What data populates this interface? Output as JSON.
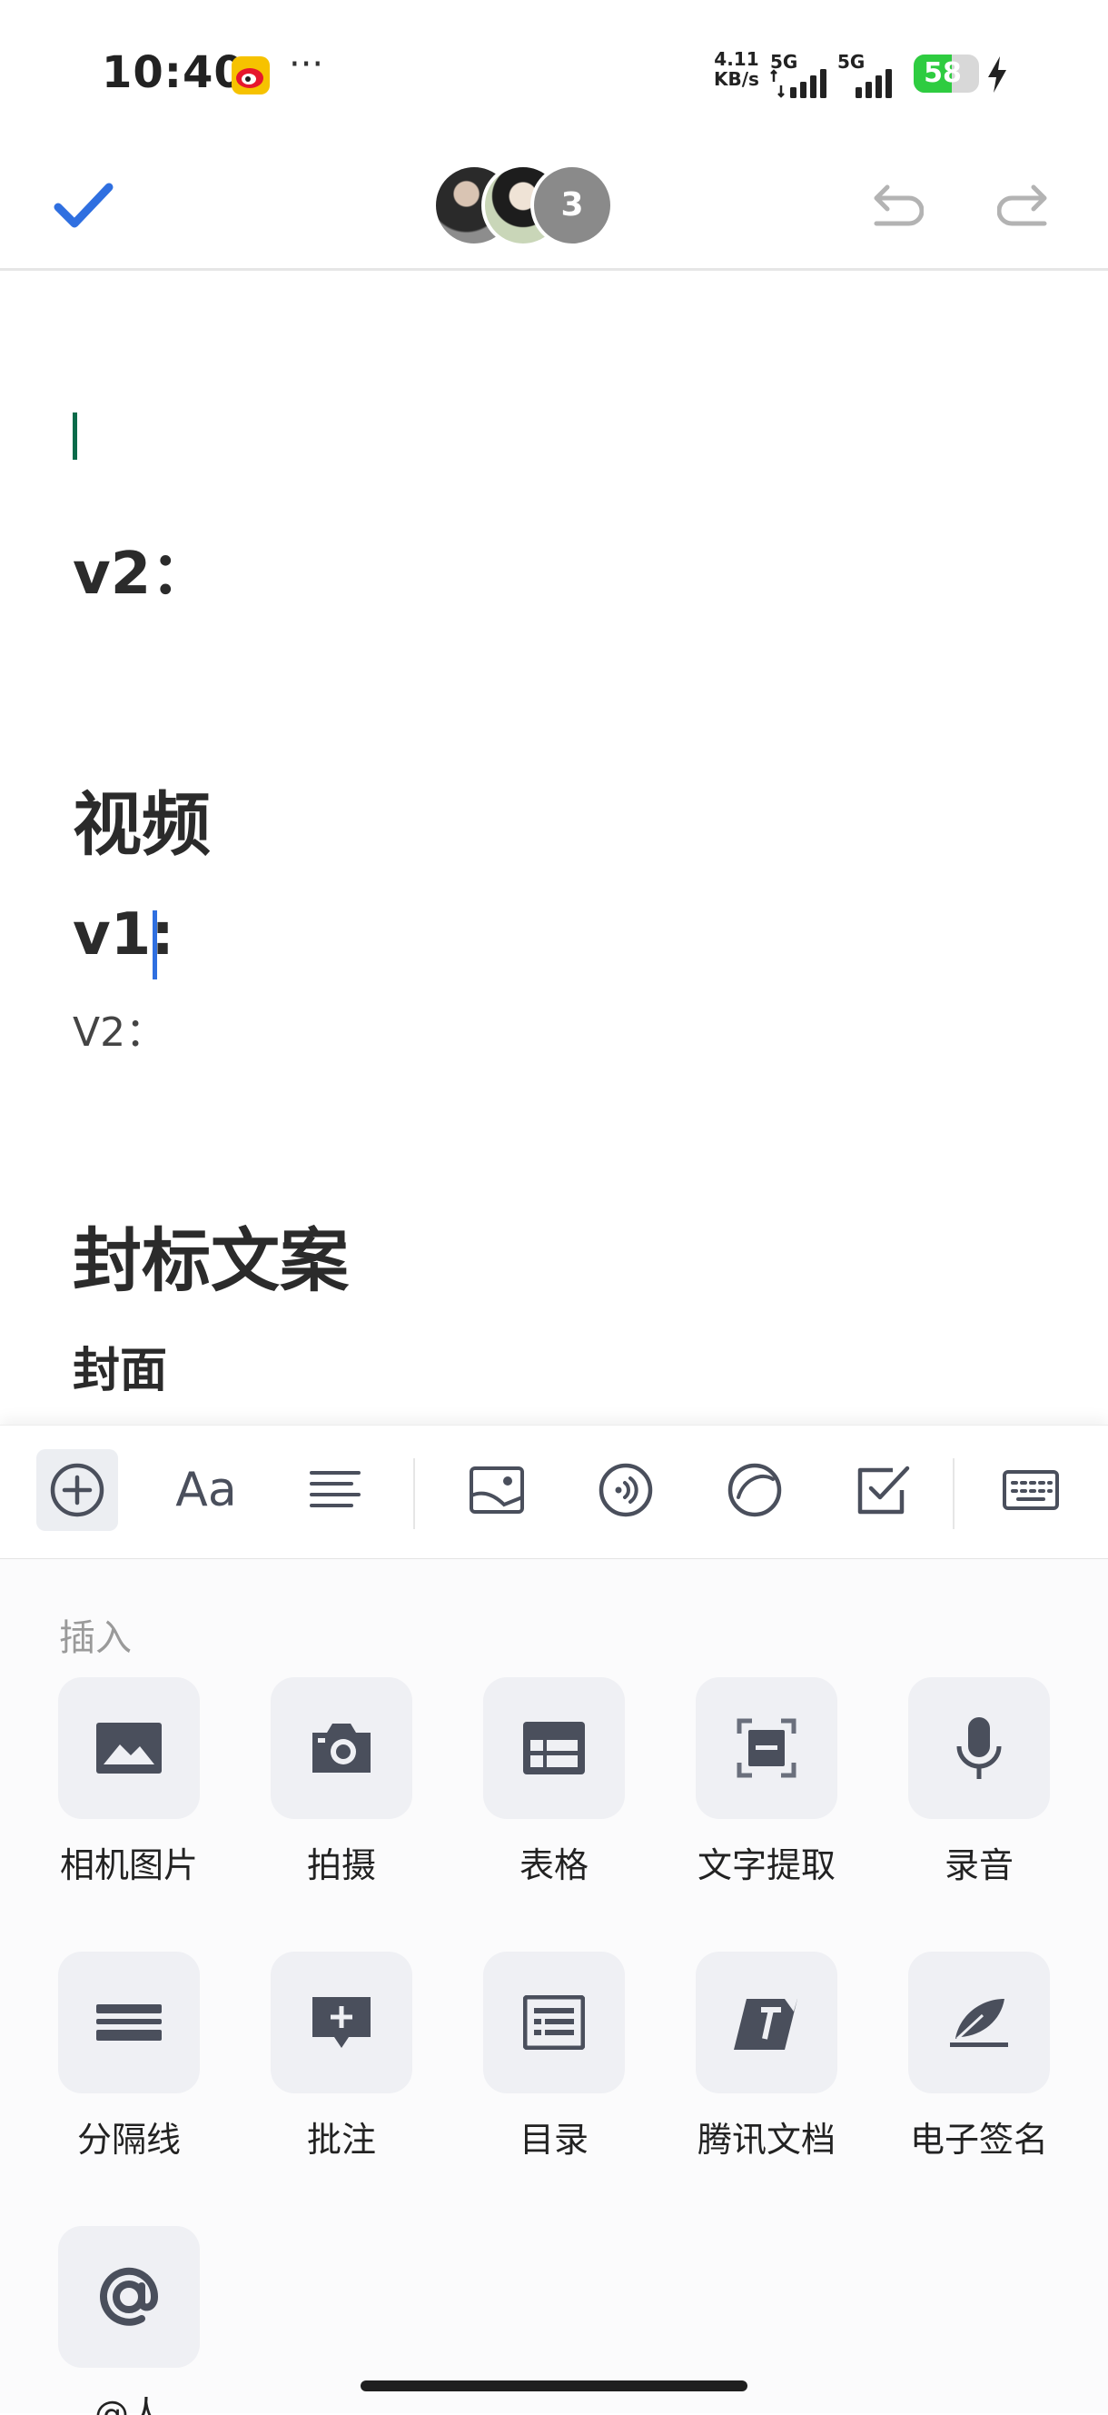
{
  "status_bar": {
    "time": "10:40",
    "net_speed_value": "4.11",
    "net_speed_unit": "KB/s",
    "signal1": "5G",
    "signal2": "5G",
    "battery": "58",
    "battery_level": 0.58,
    "icons": [
      "weibo-icon",
      "more-dots-icon",
      "signal-icon",
      "battery-icon",
      "charging-bolt-icon"
    ]
  },
  "header": {
    "collaborator_count": "3",
    "icons": [
      "check-icon",
      "undo-icon",
      "redo-icon"
    ]
  },
  "document": {
    "v2_heading": "v2：",
    "video_heading": "视频",
    "v1_heading": "v1:",
    "v2_body": "V2：",
    "cover_copy_heading": "封标文案",
    "cover_heading": "封面"
  },
  "toolbar": {
    "icons": [
      "add-circle-icon",
      "text-format-icon",
      "align-icon",
      "image-icon",
      "audio-icon",
      "emoji-icon",
      "checkbox-icon",
      "keyboard-icon"
    ],
    "format_label": "Aa"
  },
  "insert_panel": {
    "title": "插入",
    "items": [
      {
        "label": "相机图片",
        "icon": "image-icon"
      },
      {
        "label": "拍摄",
        "icon": "camera-icon"
      },
      {
        "label": "表格",
        "icon": "table-icon"
      },
      {
        "label": "文字提取",
        "icon": "text-scan-icon"
      },
      {
        "label": "录音",
        "icon": "microphone-icon"
      },
      {
        "label": "分隔线",
        "icon": "divider-icon"
      },
      {
        "label": "批注",
        "icon": "comment-add-icon"
      },
      {
        "label": "目录",
        "icon": "toc-icon"
      },
      {
        "label": "腾讯文档",
        "icon": "tencent-docs-icon"
      },
      {
        "label": "电子签名",
        "icon": "signature-icon"
      },
      {
        "label": "@人",
        "icon": "at-icon"
      }
    ]
  },
  "colors": {
    "accent": "#2f6fe0",
    "icon": "#4a4f5c",
    "tile_bg": "#eff0f4",
    "battery_green": "#2ecc40"
  }
}
